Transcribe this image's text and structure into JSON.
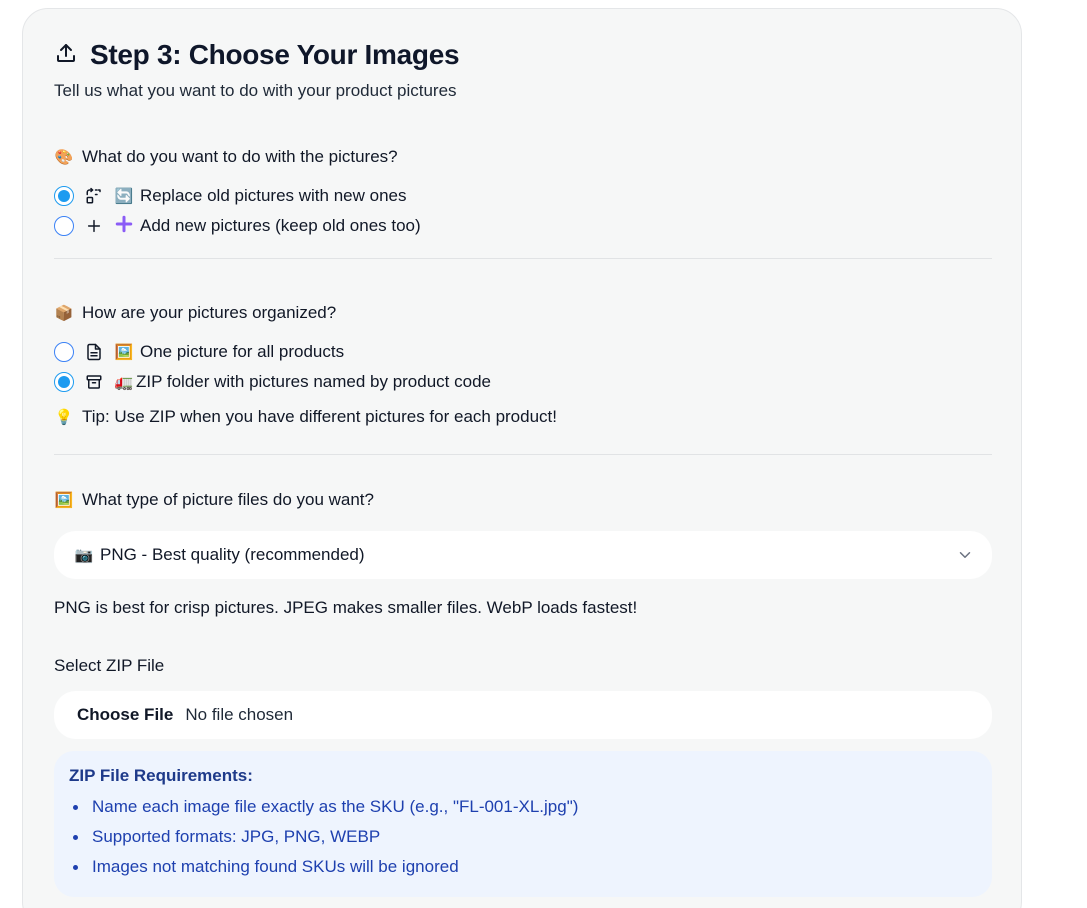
{
  "header": {
    "title": "Step 3: Choose Your Images",
    "subtitle": "Tell us what you want to do with your product pictures"
  },
  "action": {
    "question": "What do you want to do with the pictures?",
    "question_emoji": "🎨",
    "options": [
      {
        "emoji": "🔄",
        "label": "Replace old pictures with new ones",
        "selected": true,
        "icon": "replace-icon"
      },
      {
        "emoji": "➕",
        "label": "Add new pictures (keep old ones too)",
        "selected": false,
        "icon": "plus-icon"
      }
    ]
  },
  "organization": {
    "question": "How are your pictures organized?",
    "question_emoji": "📦",
    "options": [
      {
        "emoji": "🖼️",
        "label": "One picture for all products",
        "selected": false,
        "icon": "file-icon"
      },
      {
        "emoji": "🚛",
        "label": "ZIP folder with pictures named by product code",
        "selected": true,
        "icon": "archive-icon"
      }
    ],
    "tip_emoji": "💡",
    "tip": "Tip: Use ZIP when you have different pictures for each product!"
  },
  "format": {
    "question": "What type of picture files do you want?",
    "question_emoji": "🖼️",
    "selected_emoji": "📷",
    "selected": "PNG - Best quality (recommended)",
    "hint": "PNG is best for crisp pictures. JPEG makes smaller files. WebP loads fastest!"
  },
  "upload": {
    "label": "Select ZIP File",
    "button": "Choose File",
    "status": "No file chosen"
  },
  "requirements": {
    "title": "ZIP File Requirements:",
    "items": [
      "Name each image file exactly as the SKU (e.g., \"FL-001-XL.jpg\")",
      "Supported formats: JPG, PNG, WEBP",
      "Images not matching found SKUs will be ignored"
    ]
  },
  "colors": {
    "accent": "#1d9bf0",
    "card_bg": "#f6f7f7",
    "req_bg": "#eef4fe",
    "req_text": "#1e40af"
  }
}
